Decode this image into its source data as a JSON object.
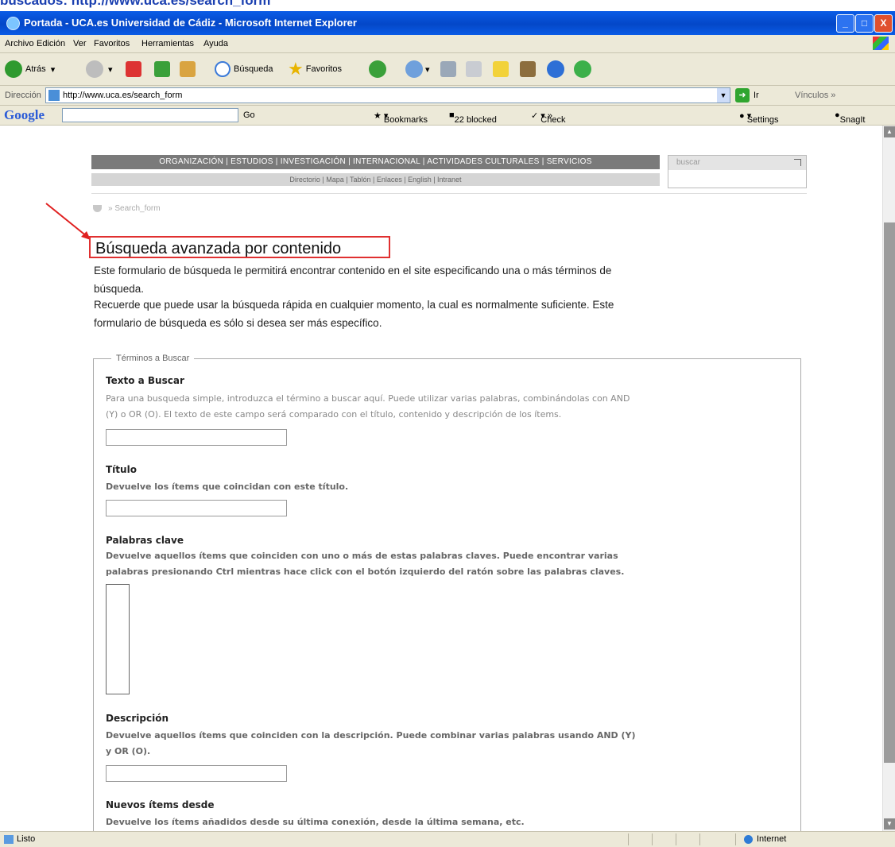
{
  "caption_fragment": "buscados: http://www.uca.es/search_form",
  "window": {
    "title": "Portada - UCA.es Universidad de Cádiz - Microsoft Internet Explorer",
    "minimize": "_",
    "maximize": "□",
    "close": "X"
  },
  "menu": [
    "Archivo",
    "Edición",
    "Ver",
    "Favoritos",
    "Herramientas",
    "Ayuda"
  ],
  "toolbar": {
    "back": "Atrás",
    "search": "Búsqueda",
    "favorites": "Favoritos"
  },
  "address": {
    "label": "Dirección",
    "url": "http://www.uca.es/search_form",
    "go": "Ir",
    "links": "Vínculos"
  },
  "google_bar": {
    "logo": "Google",
    "go": "Go",
    "bookmarks": "Bookmarks",
    "blocked": "22 blocked",
    "check": "Check",
    "settings": "Settings",
    "snagit": "SnagIt"
  },
  "site": {
    "main_nav": "ORGANIZACIÓN | ESTUDIOS | INVESTIGACIÓN | INTERNACIONAL | ACTIVIDADES CULTURALES | SERVICIOS",
    "sub_nav": "Directorio | Mapa | Tablón | Enlaces | English | Intranet",
    "search_label": "buscar",
    "breadcrumb": "» Search_form"
  },
  "page": {
    "heading": "Búsqueda avanzada por contenido",
    "intro_1": "Este formulario de búsqueda le permitirá encontrar contenido en el site especificando una o más términos de",
    "intro_2": "búsqueda.",
    "intro_3": "Recuerde que puede usar la búsqueda rápida en cualquier momento, la cual es normalmente suficiente. Este",
    "intro_4": "formulario de búsqueda es sólo si desea ser más específico."
  },
  "form": {
    "legend": "Términos a Buscar",
    "fields": {
      "text": {
        "label": "Texto a Buscar",
        "help_1": "Para una busqueda simple, introduzca el término a buscar aquí. Puede utilizar varias palabras, combinándolas con AND",
        "help_2": "(Y) o OR (O). El texto de este campo será comparado con el título, contenido y descripción de los ítems."
      },
      "title": {
        "label": "Título",
        "help": "Devuelve los ítems que coincidan con este título."
      },
      "keywords": {
        "label": "Palabras clave",
        "help_1": "Devuelve aquellos ítems que coinciden con uno o más de estas palabras claves. Puede encontrar varias",
        "help_2": "palabras presionando Ctrl mientras hace click con el botón izquierdo del ratón sobre las palabras claves."
      },
      "description": {
        "label": "Descripción",
        "help_1": "Devuelve aquellos ítems que coinciden con la descripción. Puede combinar varias palabras usando AND (Y)",
        "help_2": "y OR (O)."
      },
      "new_items": {
        "label": "Nuevos ítems desde",
        "help": "Devuelve los ítems añadidos desde su última conexión, desde la última semana, etc."
      }
    }
  },
  "status": {
    "left": "Listo",
    "zone": "Internet"
  },
  "colors": {
    "titlebar": "#0a5ce6",
    "highlight": "#e03030",
    "chrome": "#ece9d8"
  }
}
